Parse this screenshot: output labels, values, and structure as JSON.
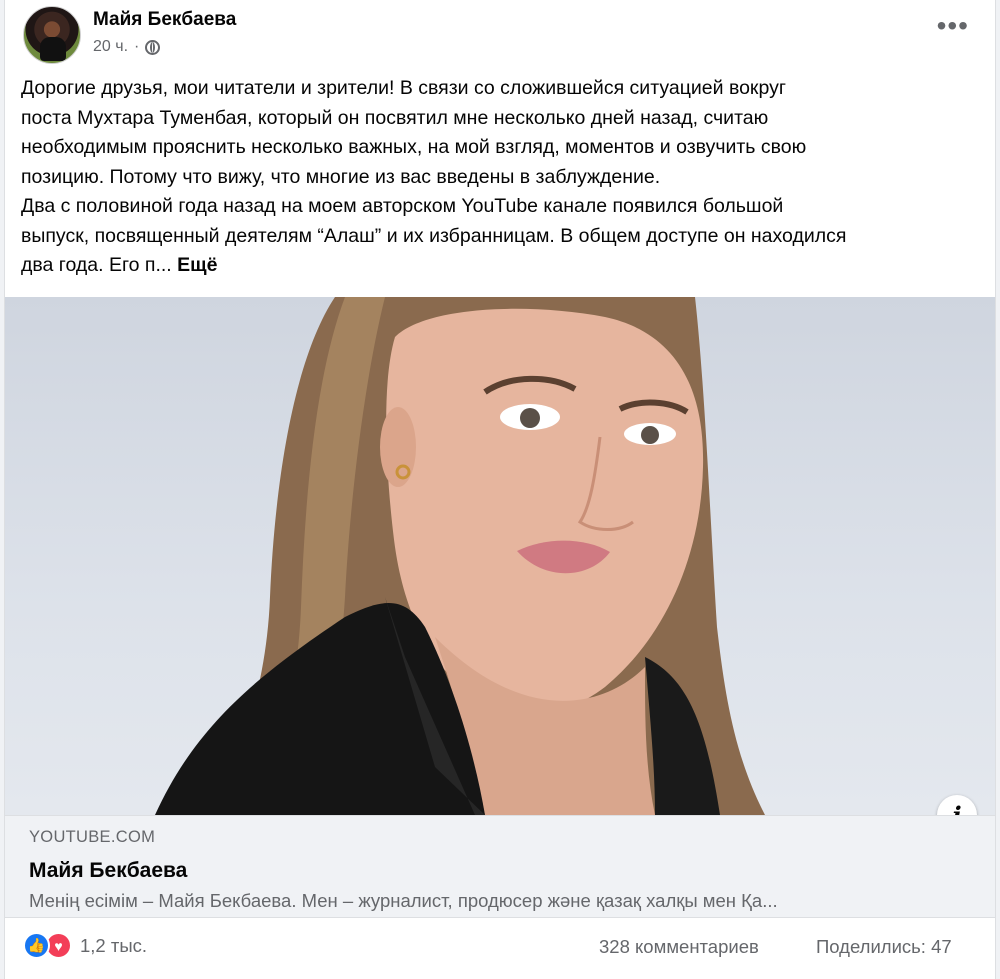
{
  "post": {
    "author": "Майя Бекбаева",
    "time": "20 ч.",
    "separator": "·",
    "text": "Дорогие друзья, мои читатели и зрители! В связи со сложившейся ситуацией вокруг\nпоста Мухтара Туменбая, который он посвятил мне несколько дней назад, считаю\nнеобходимым прояснить несколько важных, на мой взгляд, моментов и озвучить свою\nпозицию. Потому что вижу, что многие из вас введены в заблуждение.\nДва с половиной года назад на моем авторском YouTube канале появился большой\nвыпуск, посвященный деятелям “Алаш” и их избранницам. В общем доступе он находился\nдва года. Его п... ",
    "see_more": "Ещё",
    "more_icon": "•••"
  },
  "link_preview": {
    "domain": "YOUTUBE.COM",
    "title": "Майя Бекбаева",
    "description": "Менің есімім – Майя Бекбаева. Мен – журналист, продюсер және қазақ халқы мен Қа...",
    "info_icon": "i"
  },
  "footer": {
    "reactions_count": "1,2 тыс.",
    "comments": "328 комментариев",
    "shares": "Поделились: 47",
    "like_glyph": "👍",
    "love_glyph": "♥"
  },
  "colors": {
    "like": "#1877f2",
    "love": "#f33e58",
    "secondary_text": "#65676b"
  }
}
